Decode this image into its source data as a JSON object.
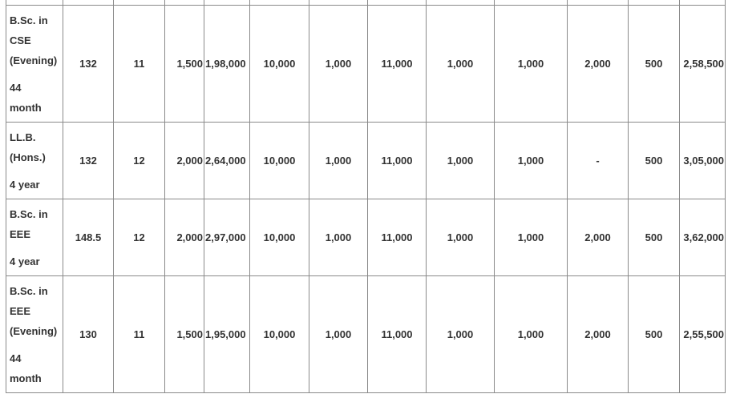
{
  "table": {
    "rows": [
      {
        "program": [
          "B.Sc. in",
          "CSE",
          "(Evening)"
        ],
        "duration": [
          "44",
          "month"
        ],
        "cells": [
          "132",
          "11",
          "1,500",
          "1,98,000",
          "10,000",
          "1,000",
          "11,000",
          "1,000",
          "1,000",
          "2,000",
          "500",
          "2,58,500"
        ]
      },
      {
        "program": [
          "LL.B.",
          "(Hons.)"
        ],
        "duration": [
          "4 year"
        ],
        "cells": [
          "132",
          "12",
          "2,000",
          "2,64,000",
          "10,000",
          "1,000",
          "11,000",
          "1,000",
          "1,000",
          "-",
          "500",
          "3,05,000"
        ]
      },
      {
        "program": [
          "B.Sc. in",
          "EEE"
        ],
        "duration": [
          "4 year"
        ],
        "cells": [
          "148.5",
          "12",
          "2,000",
          "2,97,000",
          "10,000",
          "1,000",
          "11,000",
          "1,000",
          "1,000",
          "2,000",
          "500",
          "3,62,000"
        ]
      },
      {
        "program": [
          "B.Sc. in",
          "EEE",
          "(Evening)"
        ],
        "duration": [
          "44",
          "month"
        ],
        "cells": [
          "130",
          "11",
          "1,500",
          "1,95,000",
          "10,000",
          "1,000",
          "11,000",
          "1,000",
          "1,000",
          "2,000",
          "500",
          "2,55,500"
        ]
      }
    ]
  }
}
